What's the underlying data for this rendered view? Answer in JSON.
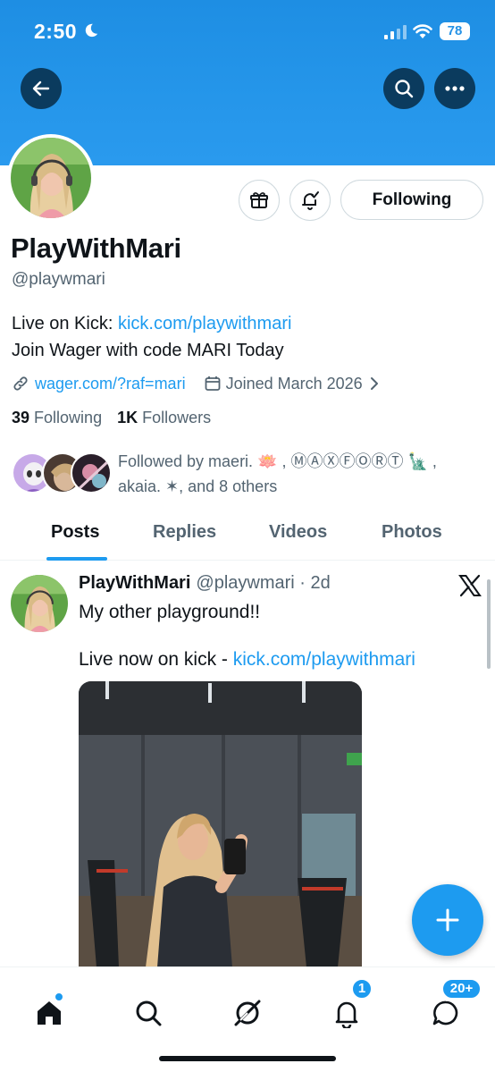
{
  "status_bar": {
    "time": "2:50",
    "battery": "78"
  },
  "profile": {
    "display_name": "PlayWithMari",
    "handle": "@playwmari",
    "follow_button": "Following",
    "bio_line1_prefix": "Live on Kick: ",
    "bio_line1_link": "kick.com/playwithmari",
    "bio_line2": "Join Wager with code MARI Today",
    "website": "wager.com/?raf=mari",
    "joined": "Joined March 2026",
    "following_count": "39",
    "following_label": "Following",
    "followers_count": "1K",
    "followers_label": "Followers",
    "followed_by_line1": "Followed by maeri. 🪷 , ⓂⒶⓍⒻⓄⓇⓉ 🗽 ,",
    "followed_by_line2": "akaia. ✶, and 8 others"
  },
  "tabs": [
    "Posts",
    "Replies",
    "Videos",
    "Photos"
  ],
  "post": {
    "author": "PlayWithMari",
    "meta": "@playwmari · 2d",
    "text": "My other playground!!",
    "link_prefix": "Live now on kick - ",
    "link": "kick.com/playwithmari"
  },
  "nav": {
    "messages_badge": "20+"
  },
  "colors": {
    "accent": "#1d9bf0",
    "banner": "#2596ea",
    "dark_button": "#0b3b5e"
  }
}
